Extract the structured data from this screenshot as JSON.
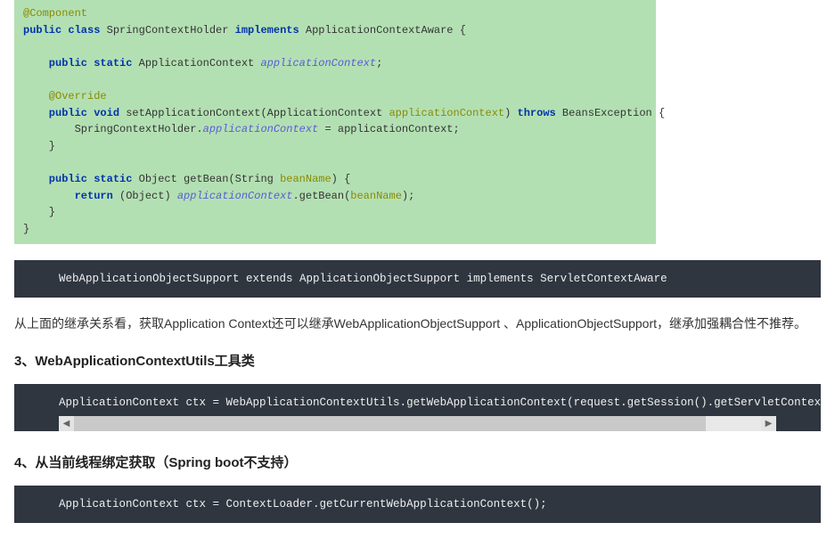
{
  "java": {
    "l01": "@Component",
    "l02_a": "public class",
    "l02_b": " SpringContextHolder ",
    "l02_c": "implements",
    "l02_d": " ApplicationContextAware {",
    "l03": "",
    "l04_a": "    public static",
    "l04_b": " ApplicationContext ",
    "l04_c": "applicationContext",
    "l04_d": ";",
    "l05": "",
    "l06": "    @Override",
    "l07_a": "    public void",
    "l07_b": " setApplicationContext(ApplicationContext ",
    "l07_c": "applicationContext",
    "l07_d": ") ",
    "l07_e": "throws",
    "l07_f": " BeansException {",
    "l08_a": "        SpringContextHolder.",
    "l08_b": "applicationContext",
    "l08_c": " = applicationContext;",
    "l09": "    }",
    "l10": "",
    "l11_a": "    public static",
    "l11_b": " Object getBean(String ",
    "l11_c": "beanName",
    "l11_d": ") {",
    "l12_a": "        return",
    "l12_b": " (Object) ",
    "l12_c": "applicationContext",
    "l12_d": ".getBean(",
    "l12_e": "beanName",
    "l12_f": ");",
    "l13": "    }",
    "l14": "}"
  },
  "dark1": "WebApplicationObjectSupport extends ApplicationObjectSupport implements ServletContextAware",
  "para1": "从上面的继承关系看，获取Application Context还可以继承WebApplicationObjectSupport 、ApplicationObjectSupport，继承加强耦合性不推荐。",
  "heading3": "3、WebApplicationContextUtils工具类",
  "dark2": "ApplicationContext ctx = WebApplicationContextUtils.getWebApplicationContext(request.getSession().getServletContext(",
  "heading4": "4、从当前线程绑定获取（Spring boot不支持）",
  "dark3": "ApplicationContext ctx = ContextLoader.getCurrentWebApplicationContext();",
  "scroll": {
    "left_arrow": "◀",
    "right_arrow": "▶"
  }
}
